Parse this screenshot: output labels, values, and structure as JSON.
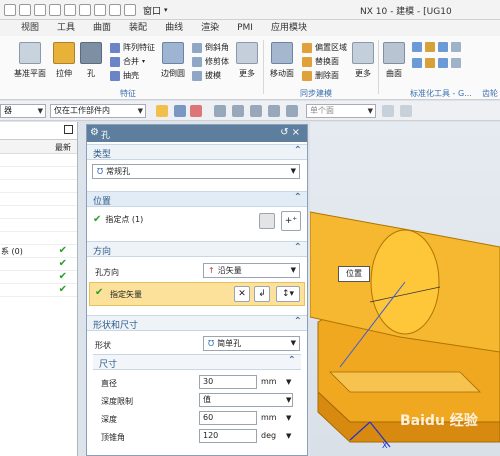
{
  "window": {
    "title": "NX 10 - 建模 - [UG10",
    "quick_access": {
      "window_menu": "窗口"
    }
  },
  "tabs": [
    "视图",
    "工具",
    "曲面",
    "装配",
    "曲线",
    "渲染",
    "PMI",
    "应用模块"
  ],
  "ribbon": {
    "buttons": {
      "datum_plane": "基准平面",
      "extrude": "拉伸",
      "hole": "孔",
      "pattern_feature": "阵列特征",
      "unite": "合并",
      "shell": "抽壳",
      "edge_blend": "边倒圆",
      "chamfer": "倒斜角",
      "trim_body": "修剪体",
      "draft": "拔模",
      "more1": "更多",
      "move_face": "移动面",
      "offset_region": "偏置区域",
      "replace_face": "替换面",
      "delete_face": "删除面",
      "more2": "更多",
      "surface": "曲面",
      "more3": "更多"
    },
    "groups": {
      "feature": "特征",
      "sync_modeling": "同步建模",
      "standard_parts": "标准化工具 - G...",
      "gear": "齿轮"
    }
  },
  "selection_bar": {
    "filter": "器",
    "scope": "仅在工作部件内",
    "snap": "单个面"
  },
  "navigator": {
    "header_col": "最新",
    "rows": [
      {
        "label": "",
        "check": false
      },
      {
        "label": "",
        "check": false
      },
      {
        "label": "",
        "check": false
      },
      {
        "label": "",
        "check": false
      },
      {
        "label": "",
        "check": false
      },
      {
        "label": "",
        "check": false
      },
      {
        "label": "",
        "check": false
      },
      {
        "label": "系 (0)",
        "check": true
      },
      {
        "label": "",
        "check": true
      },
      {
        "label": "",
        "check": true
      },
      {
        "label": "",
        "check": true
      }
    ]
  },
  "dialog": {
    "title": "孔",
    "type_section": "类型",
    "type_value": "常规孔",
    "position_section": "位置",
    "specify_point": "指定点 (1)",
    "direction_section": "方向",
    "hole_direction_label": "孔方向",
    "hole_direction_value": "沿矢量",
    "specify_vector": "指定矢量",
    "shape_section": "形状和尺寸",
    "shape_label": "形状",
    "shape_value": "简单孔",
    "dims_section": "尺寸",
    "dims": [
      {
        "label": "直径",
        "value": "30",
        "unit": "mm"
      },
      {
        "label": "深度限制",
        "value": "值",
        "unit": ""
      },
      {
        "label": "深度",
        "value": "60",
        "unit": "mm"
      },
      {
        "label": "顶锥角",
        "value": "120",
        "unit": "deg"
      }
    ]
  },
  "viewport": {
    "tooltip": "位置",
    "watermark": "Baidu 经验",
    "axis_label": "X"
  },
  "colors": {
    "model_orange": "#f1b324",
    "dialog_title": "#5d7f9d",
    "highlight": "#fbe199",
    "check_green": "#2a9d2a",
    "section_text": "#2f5c8a"
  }
}
